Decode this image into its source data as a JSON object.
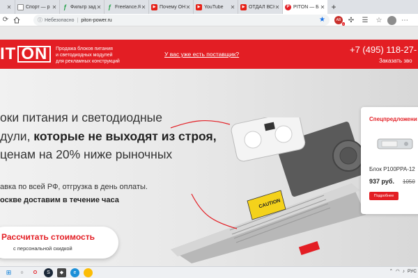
{
  "browser": {
    "tabs": [
      {
        "title": "",
        "favicon": "document-icon",
        "closable": true
      },
      {
        "title": "Спорт — p",
        "favicon": "document-icon"
      },
      {
        "title": "Фильтр зад",
        "favicon": "freelance-icon"
      },
      {
        "title": "Freelance.Ru",
        "favicon": "freelance-icon"
      },
      {
        "title": "Почему OH",
        "favicon": "youtube-icon"
      },
      {
        "title": "YouTube",
        "favicon": "youtube-icon"
      },
      {
        "title": "ОТДАЛ ВСЮ",
        "favicon": "youtube-icon"
      },
      {
        "title": "PITON — Б",
        "favicon": "piton-icon",
        "active": true
      }
    ],
    "new_tab_label": "+",
    "address": {
      "security": "Небезопасно",
      "separator": "|",
      "url": "piton-power.ru"
    },
    "extension_badge": "1"
  },
  "site": {
    "logo": {
      "left": "IT",
      "right": "ON"
    },
    "tagline": [
      "Продажа блоков питания",
      "и светодиодных модулей",
      "для рекламных конструкций"
    ],
    "supplier_link": "У вас уже есть поставщик?",
    "phone": "+7 (495) 118-27-",
    "callback": "Заказать зво"
  },
  "hero": {
    "headline": {
      "line1": "оки питания и светодиодные",
      "line2_a": "дули, ",
      "line2_b": "которые не выходят из строя,",
      "line3": "ценам на 20% ниже рыночных"
    },
    "sub1": "авка по всей РФ, отгрузка в день оплаты.",
    "sub2": "оскве доставим в течение часа",
    "cta": {
      "label": "Рассчитать стоимость",
      "sublabel": "с персональной скидкой"
    }
  },
  "offer": {
    "title": "Спецпредложени",
    "product": "Блок P100PPA-12",
    "price": "937 руб.",
    "old_price": "1050",
    "button": "Подробнее"
  },
  "taskbar": {
    "lang": "РУС"
  },
  "colors": {
    "brand_red": "#e31e24",
    "header_text": "#ffffff"
  }
}
